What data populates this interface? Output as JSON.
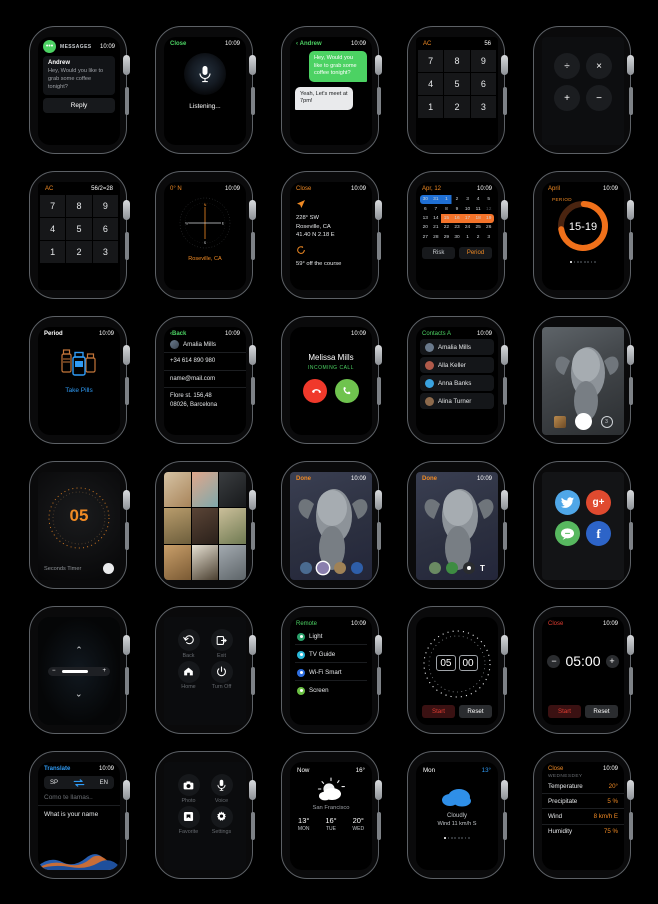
{
  "time": "10:09",
  "screens": {
    "messages": {
      "time": "10:09",
      "app_label": "MESSAGES",
      "sender": "Andrew",
      "body": "Hey, Would you like to grab some coffee tonight?",
      "reply_label": "Reply"
    },
    "siri": {
      "close_label": "Close",
      "time": "10:09",
      "status": "Listening...",
      "icon": "microphone-icon"
    },
    "chat": {
      "back_label": "Andrew",
      "time": "10:09",
      "messages": [
        {
          "text": "Hey, Would you like to grab some coffee tonight?",
          "from": "me"
        },
        {
          "text": "Yeah, Let's meet at 7pm!",
          "from": "them"
        }
      ]
    },
    "calculator_keys": {
      "clear_label": "AC",
      "display": "56",
      "keys": [
        "7",
        "8",
        "9",
        "4",
        "5",
        "6",
        "1",
        "2",
        "3"
      ]
    },
    "calculator_ops": {
      "ops": [
        "÷",
        "×",
        "+",
        "−"
      ]
    },
    "calculator_result": {
      "clear_label": "AC",
      "display": "56/2=28",
      "keys": [
        "7",
        "8",
        "9",
        "4",
        "5",
        "6",
        "1",
        "2",
        "3"
      ]
    },
    "compass": {
      "heading": "0° N",
      "time": "10:09",
      "location": "Roseville, CA",
      "cardinals": [
        "N",
        "E",
        "S",
        "W"
      ]
    },
    "navigation": {
      "close_label": "Close",
      "time": "10:09",
      "bearing": "228° SW",
      "place": "Roseville, CA",
      "coords": "41.40 N 2.18 E",
      "course": "59° off the course"
    },
    "calendar": {
      "month_label": "Apr, 12",
      "time": "10:09",
      "weeks": [
        [
          "30",
          "31",
          "1",
          "2",
          "3",
          "4",
          "5"
        ],
        [
          "6",
          "7",
          "8",
          "9",
          "10",
          "11",
          "12"
        ],
        [
          "13",
          "14",
          "15",
          "16",
          "17",
          "18",
          "19"
        ],
        [
          "20",
          "21",
          "22",
          "23",
          "24",
          "25",
          "26"
        ],
        [
          "27",
          "28",
          "29",
          "30",
          "1",
          "2",
          "3"
        ]
      ],
      "blue_range": {
        "week": 0,
        "start": 0,
        "end": 2
      },
      "orange_range": {
        "week": 2,
        "start": 2,
        "end": 6
      },
      "dim_cells": [
        [
          1,
          6
        ]
      ],
      "buttons": [
        {
          "label": "Risk",
          "color": "#c8ccd0"
        },
        {
          "label": "Period",
          "color": "#f08a24"
        }
      ]
    },
    "period_ring": {
      "title": "April",
      "time": "10:09",
      "ring_label": "PERIOD",
      "range": "15-19",
      "progress_pct": 72,
      "ring_color": "#f0701a",
      "track_color": "#4a2410"
    },
    "pills": {
      "title": "Period",
      "time": "10:09",
      "action_label": "Take Pills",
      "icon": "pill-bottles-icon"
    },
    "contact_detail": {
      "back_label": "Back",
      "time": "10:09",
      "name": "Amalia Mills",
      "rows": [
        "+34 614 890 980",
        "name@mail.com",
        "Flore st. 156,48\n08026, Barcelona"
      ]
    },
    "incoming_call": {
      "time": "10:09",
      "caller": "Melissa Mills",
      "status": "INCOMING CALL",
      "decline_icon": "phone-decline-icon",
      "accept_icon": "phone-accept-icon"
    },
    "contacts_list": {
      "title": "Contacts A",
      "time": "10:09",
      "items": [
        {
          "name": "Amalia Mills",
          "color": "#6a7a8c"
        },
        {
          "name": "Alla Keller",
          "color": "#b05a4a"
        },
        {
          "name": "Anna Banks",
          "color": "#3aa3e0"
        },
        {
          "name": "Alina Turner",
          "color": "#8d6a4c"
        }
      ]
    },
    "camera": {
      "shutter_icon": "shutter-icon",
      "timer_label": "3",
      "thumbnail_icon": "last-photo-thumbnail"
    },
    "seconds_timer": {
      "value": "05",
      "label": "Seconds Timer",
      "button_icon": "timer-button-icon"
    },
    "photo_grid": {
      "tiles": [
        "#c3a387",
        "#d8a68c",
        "#2e3134",
        "#9c7a50",
        "#5a4436",
        "#cbbf9a",
        "#b08a5c",
        "#d8d2c4",
        "#7e8a90"
      ]
    },
    "photo_editor_1": {
      "done_label": "Done",
      "time": "10:09",
      "swatches": [
        "#4a6b90",
        "#8a7fae",
        "#a08256",
        "#2e5ea8"
      ],
      "selected_index": 1
    },
    "photo_editor_2": {
      "done_label": "Done",
      "time": "10:09",
      "swatches": [
        "#6a8a62",
        "#3e8c42"
      ],
      "brush_icon": "brush-dot-icon",
      "text_icon": "T"
    },
    "social": {
      "items": [
        {
          "name": "twitter-icon",
          "color": "#4fa7e8",
          "glyph": "🐦"
        },
        {
          "name": "google-plus-icon",
          "color": "#e04a2f",
          "glyph": "g+"
        },
        {
          "name": "message-icon",
          "color": "#57b85f",
          "glyph": "💬"
        },
        {
          "name": "facebook-icon",
          "color": "#2d64c8",
          "glyph": "f"
        }
      ]
    },
    "volume": {
      "up_icon": "chevron-up-icon",
      "down_icon": "chevron-down-icon",
      "minus_label": "−",
      "plus_label": "+",
      "level_pct": 40
    },
    "device_menu": {
      "items": [
        {
          "label": "Back",
          "icon": "undo-icon"
        },
        {
          "label": "Exit",
          "icon": "exit-icon"
        },
        {
          "label": "Home",
          "icon": "home-icon"
        },
        {
          "label": "Turn Off",
          "icon": "power-icon"
        }
      ]
    },
    "remote": {
      "title": "Remote",
      "time": "10:09",
      "items": [
        {
          "label": "Light",
          "color": "#2aa06a"
        },
        {
          "label": "TV Guide",
          "color": "#2ab8d8"
        },
        {
          "label": "Wi-Fi Smart",
          "color": "#2f6fe0"
        },
        {
          "label": "Screen",
          "color": "#6bc043"
        }
      ]
    },
    "stopwatch": {
      "minutes": "05",
      "seconds": "00",
      "start_label": "Start",
      "reset_label": "Reset"
    },
    "countdown": {
      "close_label": "Close",
      "time": "10:09",
      "value": "05:00",
      "minus_label": "−",
      "plus_label": "+",
      "start_label": "Start",
      "reset_label": "Reset"
    },
    "translate": {
      "title": "Translate",
      "time": "10:09",
      "lang_from": "SP",
      "lang_to": "EN",
      "swap_icon": "swap-arrows-icon",
      "source_text": "Como te llamas..",
      "target_text": "What is your name"
    },
    "app_menu": {
      "items": [
        {
          "label": "Photo",
          "icon": "camera-icon"
        },
        {
          "label": "Voice",
          "icon": "microphone-icon"
        },
        {
          "label": "Favorite",
          "icon": "archive-icon"
        },
        {
          "label": "Settings",
          "icon": "gear-icon"
        }
      ]
    },
    "weather_now": {
      "label": "Now",
      "temp": "16°",
      "city": "San Francisco",
      "icon": "sun-cloud-icon",
      "forecast": [
        {
          "temp": "13°",
          "day": "MON"
        },
        {
          "temp": "16°",
          "day": "TUE"
        },
        {
          "temp": "20°",
          "day": "WED"
        }
      ]
    },
    "weather_day": {
      "label": "Mon",
      "temp": "13°",
      "icon": "cloud-icon",
      "condition": "Cloudly",
      "wind": "Wind 11 km/h S"
    },
    "weather_detail": {
      "close_label": "Close",
      "time": "10:09",
      "day_label": "WEDNESDEY",
      "rows": [
        {
          "key": "Temperature",
          "value": "20°"
        },
        {
          "key": "Precipitate",
          "value": "5 %"
        },
        {
          "key": "Wind",
          "value": "8 km/h E"
        },
        {
          "key": "Humidity",
          "value": "75 %"
        }
      ]
    }
  }
}
